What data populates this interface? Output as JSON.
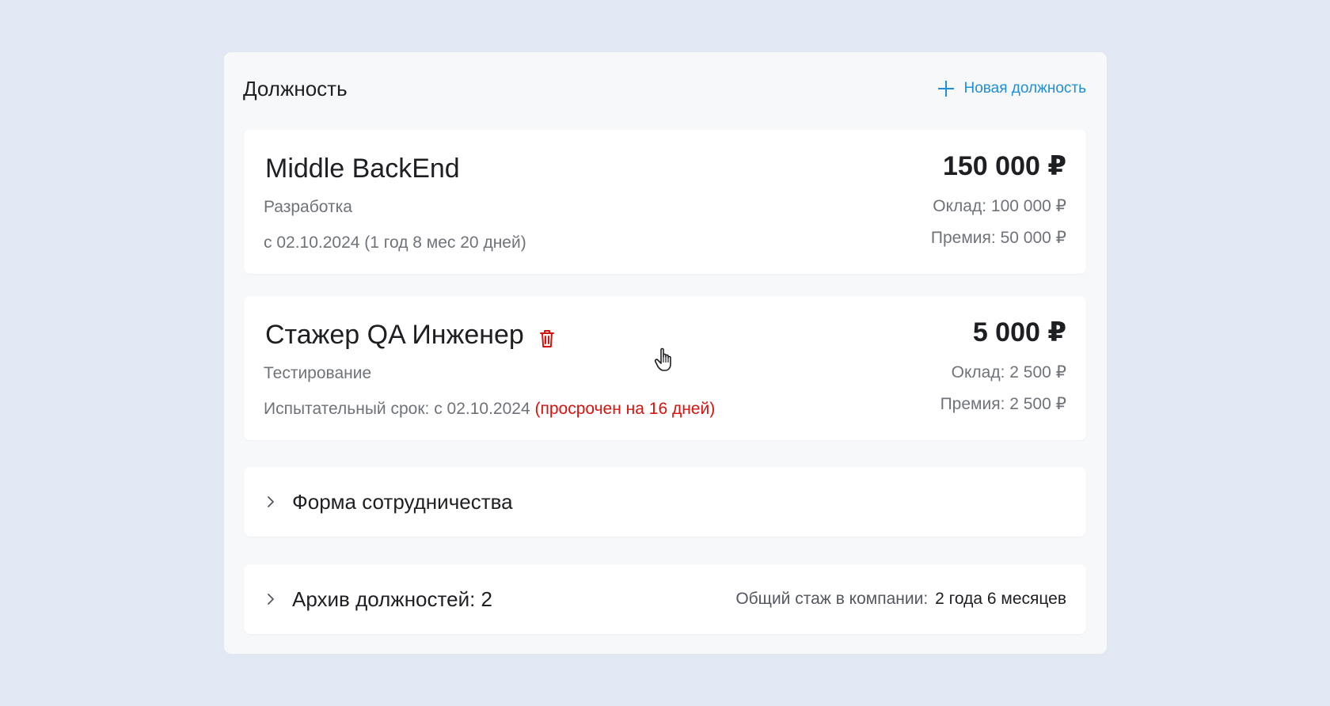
{
  "header": {
    "title": "Должность",
    "new_position_label": "Новая должность"
  },
  "positions": [
    {
      "title": "Middle BackEnd",
      "department": "Разработка",
      "date_text": "с 02.10.2024 (1 год 8 мес 20 дней)",
      "total": "150 000 ₽",
      "salary": "Оклад: 100 000 ₽",
      "bonus": "Премия: 50 000 ₽"
    },
    {
      "title": "Стажер QA Инженер",
      "department": "Тестирование",
      "date_text": "Испытательный срок: с 02.10.2024",
      "overdue_text": "(просрочен на 16 дней)",
      "total": "5 000 ₽",
      "salary": "Оклад: 2 500 ₽",
      "bonus": "Премия: 2 500 ₽",
      "delete_icon": "trash-icon"
    }
  ],
  "cooperation": {
    "label": "Форма сотрудничества"
  },
  "archive": {
    "label": "Архив должностей: 2",
    "tenure_label": "Общий стаж в компании:",
    "tenure_value": "2 года 6 месяцев"
  },
  "colors": {
    "accent": "#1f8fd6",
    "danger": "#d6130f",
    "background": "#e1e8f4"
  }
}
